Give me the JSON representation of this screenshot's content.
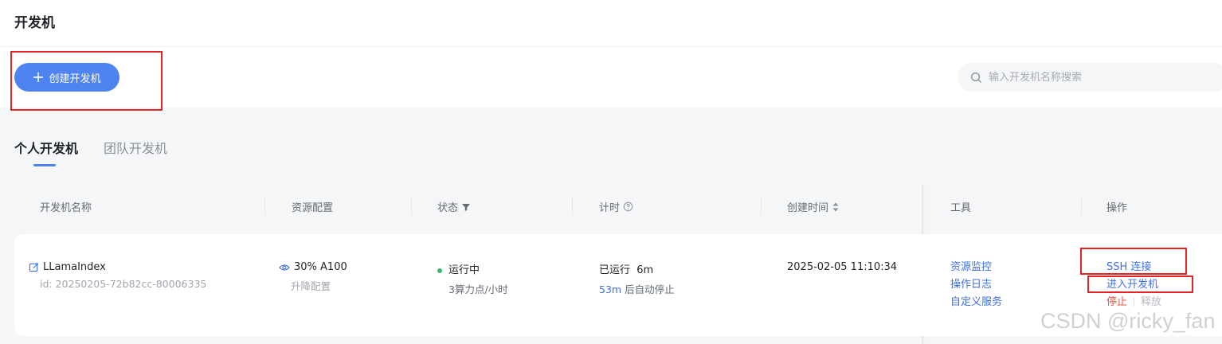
{
  "page": {
    "title": "开发机"
  },
  "toolbar": {
    "create_label": "创建开发机",
    "search_placeholder": "输入开发机名称搜索"
  },
  "tabs": [
    {
      "label": "个人开发机",
      "active": true
    },
    {
      "label": "团队开发机",
      "active": false
    }
  ],
  "table": {
    "columns": {
      "name": "开发机名称",
      "resource": "资源配置",
      "status": "状态",
      "timer": "计时",
      "created": "创建时间",
      "tools": "工具",
      "actions": "操作"
    },
    "rows": [
      {
        "name": "LLamaIndex",
        "id": "id: 20250205-72b82cc-80006335",
        "resource": "30% A100",
        "resource_action": "升降配置",
        "status": "运行中",
        "status_sub": "3算力点/小时",
        "timer_label": "已运行",
        "timer_value": "6m",
        "auto_stop_value": "53m",
        "auto_stop_label": "后自动停止",
        "created": "2025-02-05 11:10:34",
        "tools": [
          "资源监控",
          "操作日志",
          "自定义服务"
        ],
        "ops": {
          "ssh": "SSH 连接",
          "enter": "进入开发机",
          "stop": "停止",
          "release": "释放"
        }
      }
    ]
  },
  "watermark": "CSDN @ricky_fan",
  "colors": {
    "accent": "#4e83f0",
    "link": "#3e71e8",
    "danger": "#e5553f",
    "running": "#3cb371",
    "annotation": "#e32424"
  }
}
